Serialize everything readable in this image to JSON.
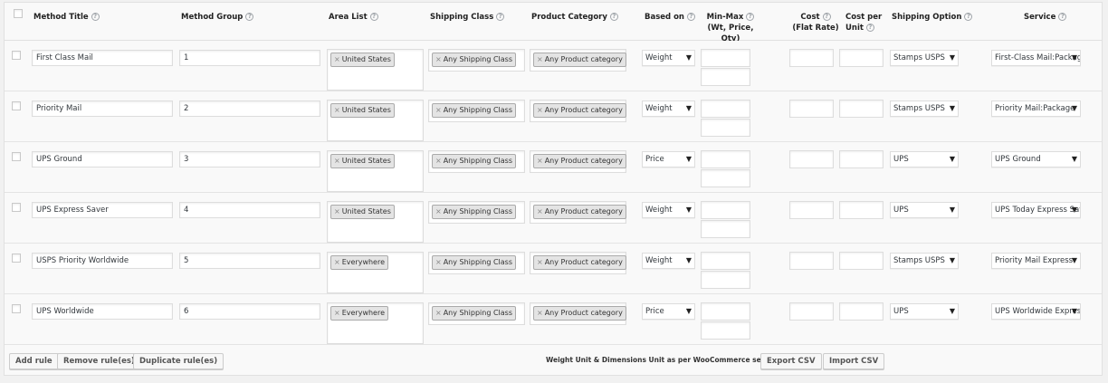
{
  "columns": {
    "method_title": "Method Title",
    "method_group": "Method Group",
    "area_list": "Area List",
    "shipping_class": "Shipping Class",
    "product_category": "Product Category",
    "based_on": "Based on",
    "min_max": "Min-Max",
    "min_max_sub": "(Wt, Price, Qty)",
    "cost_flat_1": "Cost",
    "cost_flat_2": "(Flat Rate)",
    "cost_unit_1": "Cost per",
    "cost_unit_2": "Unit",
    "shipping_option": "Shipping Option",
    "service": "Service",
    "help_glyph": "?"
  },
  "rows": [
    {
      "title": "First Class Mail",
      "group": "1",
      "area": "United States",
      "shipping_class": "Any Shipping Class",
      "product_category": "Any Product category",
      "based_on": "Weight",
      "shipping_option": "Stamps USPS",
      "service": "First-Class Mail:Package"
    },
    {
      "title": "Priority Mail",
      "group": "2",
      "area": "United States",
      "shipping_class": "Any Shipping Class",
      "product_category": "Any Product category",
      "based_on": "Weight",
      "shipping_option": "Stamps USPS",
      "service": "Priority Mail:Package"
    },
    {
      "title": "UPS Ground",
      "group": "3",
      "area": "United States",
      "shipping_class": "Any Shipping Class",
      "product_category": "Any Product category",
      "based_on": "Price",
      "shipping_option": "UPS",
      "service": "UPS Ground"
    },
    {
      "title": "UPS Express Saver",
      "group": "4",
      "area": "United States",
      "shipping_class": "Any Shipping Class",
      "product_category": "Any Product category",
      "based_on": "Weight",
      "shipping_option": "UPS",
      "service": "UPS Today Express Saver"
    },
    {
      "title": "USPS Priority Worldwide",
      "group": "5",
      "area": "Everywhere",
      "shipping_class": "Any Shipping Class",
      "product_category": "Any Product category",
      "based_on": "Weight",
      "shipping_option": "Stamps USPS",
      "service": "Priority Mail Express"
    },
    {
      "title": "UPS Worldwide",
      "group": "6",
      "area": "Everywhere",
      "shipping_class": "Any Shipping Class",
      "product_category": "Any Product category",
      "based_on": "Price",
      "shipping_option": "UPS",
      "service": "UPS Worldwide Express"
    }
  ],
  "tag_remove_glyph": "×",
  "dropdown_glyph": "▼",
  "footer": {
    "add_rule": "Add rule",
    "remove_rules": "Remove rule(es)",
    "duplicate_rules": "Duplicate rule(es)",
    "note": "Weight Unit & Dimensions Unit as per WooCommerce settings.",
    "export_csv": "Export CSV",
    "import_csv": "Import CSV"
  }
}
